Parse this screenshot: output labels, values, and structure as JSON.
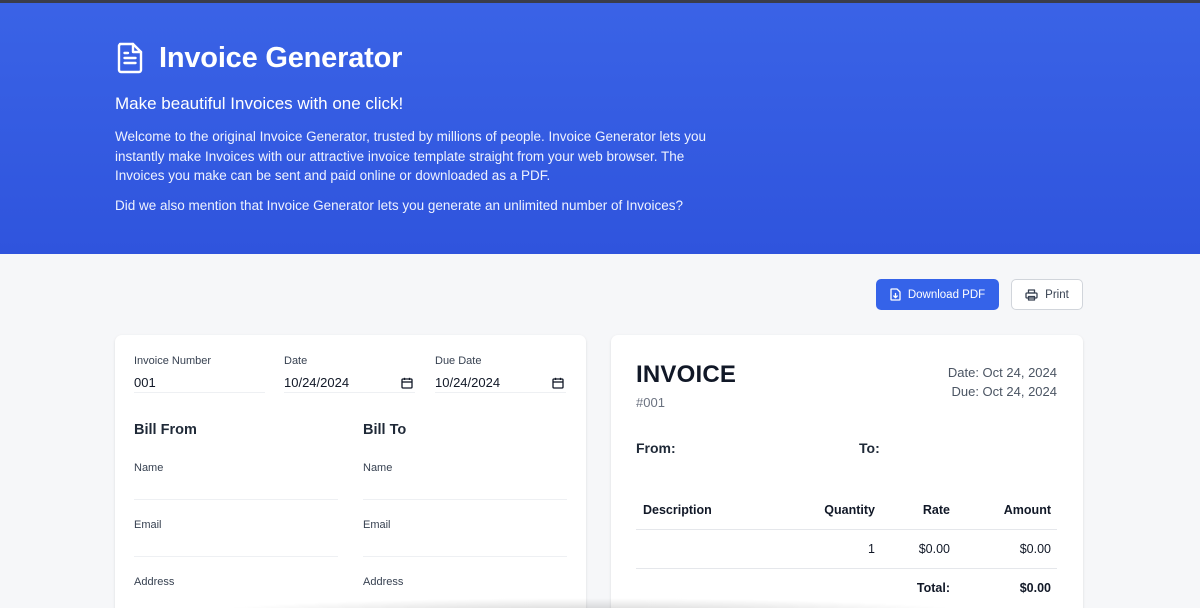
{
  "hero": {
    "title": "Invoice Generator",
    "subtitle": "Make beautiful Invoices with one click!",
    "paragraph1": "Welcome to the original Invoice Generator, trusted by millions of people. Invoice Generator lets you instantly make Invoices with our attractive invoice template straight from your web browser. The Invoices you make can be sent and paid online or downloaded as a PDF.",
    "paragraph2": "Did we also mention that Invoice Generator lets you generate an unlimited number of Invoices?",
    "icon": "document-icon"
  },
  "toolbar": {
    "download_label": "Download PDF",
    "download_icon": "file-download-icon",
    "print_label": "Print",
    "print_icon": "printer-icon"
  },
  "form": {
    "invoice_number_label": "Invoice Number",
    "invoice_number_value": "001",
    "date_label": "Date",
    "date_value": "10/24/2024",
    "due_date_label": "Due Date",
    "due_date_value": "10/24/2024",
    "bill_from_heading": "Bill From",
    "bill_to_heading": "Bill To",
    "from_name_label": "Name",
    "from_name_value": "",
    "from_email_label": "Email",
    "from_email_value": "",
    "from_address_label": "Address",
    "to_name_label": "Name",
    "to_name_value": "",
    "to_email_label": "Email",
    "to_email_value": "",
    "to_address_label": "Address"
  },
  "preview": {
    "title": "INVOICE",
    "number": "#001",
    "date_line": "Date: Oct 24, 2024",
    "due_line": "Due: Oct 24, 2024",
    "from_label": "From:",
    "to_label": "To:",
    "columns": [
      "Description",
      "Quantity",
      "Rate",
      "Amount"
    ],
    "rows": [
      {
        "description": "",
        "quantity": "1",
        "rate": "$0.00",
        "amount": "$0.00"
      }
    ],
    "total_label": "Total:",
    "total_value": "$0.00"
  },
  "colors": {
    "hero_bg": "#3a63e6",
    "primary_button": "#3563e9",
    "page_bg": "#f6f7f9"
  }
}
